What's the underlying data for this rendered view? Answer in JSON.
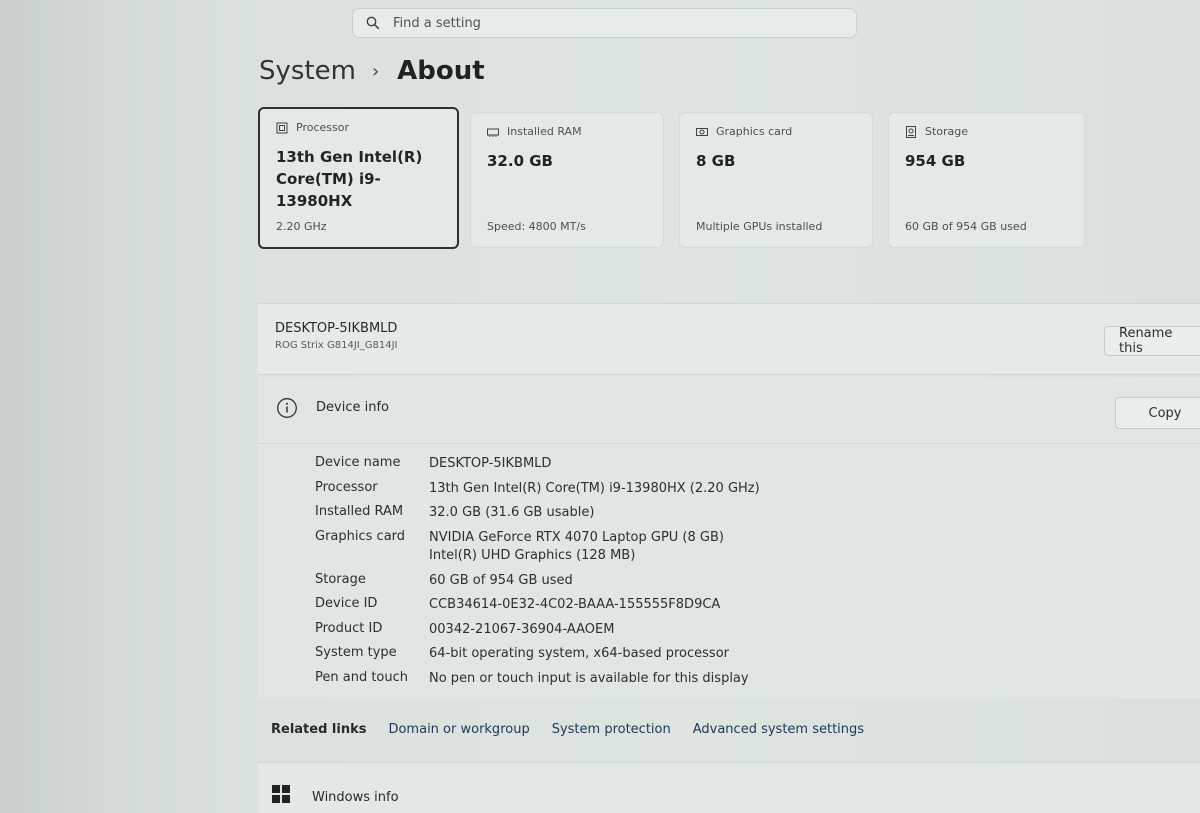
{
  "search": {
    "placeholder": "Find a setting",
    "icon": "search-icon"
  },
  "breadcrumb": {
    "parent": "System",
    "separator": "›",
    "current": "About"
  },
  "cards": [
    {
      "icon": "processor-icon",
      "label": "Processor",
      "value_line1": "13th Gen Intel(R)",
      "value_line2": "Core(TM) i9-13980HX",
      "sub": "2.20 GHz",
      "selected": true
    },
    {
      "icon": "ram-icon",
      "label": "Installed RAM",
      "value_line1": "32.0 GB",
      "sub": "Speed: 4800 MT/s"
    },
    {
      "icon": "graphics-card-icon",
      "label": "Graphics card",
      "value_line1": "8 GB",
      "sub": "Multiple GPUs installed"
    },
    {
      "icon": "storage-icon",
      "label": "Storage",
      "value_line1": "954 GB",
      "sub": "60 GB of 954 GB used"
    }
  ],
  "device_header": {
    "pc_name": "DESKTOP-5IKBMLD",
    "model": "ROG Strix G814JI_G814JI",
    "rename_label": "Rename this"
  },
  "device_info": {
    "title": "Device info",
    "copy_label": "Copy",
    "specs": {
      "device_name": {
        "key": "Device name",
        "value": "DESKTOP-5IKBMLD"
      },
      "processor": {
        "key": "Processor",
        "value": "13th Gen Intel(R) Core(TM) i9-13980HX (2.20 GHz)"
      },
      "ram": {
        "key": "Installed RAM",
        "value": "32.0 GB (31.6 GB usable)"
      },
      "graphics": {
        "key": "Graphics card",
        "value": "NVIDIA GeForce RTX 4070 Laptop GPU (8 GB)",
        "value2": "Intel(R) UHD Graphics (128 MB)"
      },
      "storage": {
        "key": "Storage",
        "value": "60 GB of 954 GB used"
      },
      "device_id": {
        "key": "Device ID",
        "value": "CCB34614-0E32-4C02-BAAA-155555F8D9CA"
      },
      "product_id": {
        "key": "Product ID",
        "value": "00342-21067-36904-AAOEM"
      },
      "system_type": {
        "key": "System type",
        "value": "64-bit operating system, x64-based processor"
      },
      "pen_touch": {
        "key": "Pen and touch",
        "value": "No pen or touch input is available for this display"
      }
    }
  },
  "related_links": {
    "label": "Related links",
    "links": [
      "Domain or workgroup",
      "System protection",
      "Advanced system settings"
    ]
  },
  "windows_info": {
    "title": "Windows info",
    "icon": "windows-logo-icon"
  }
}
